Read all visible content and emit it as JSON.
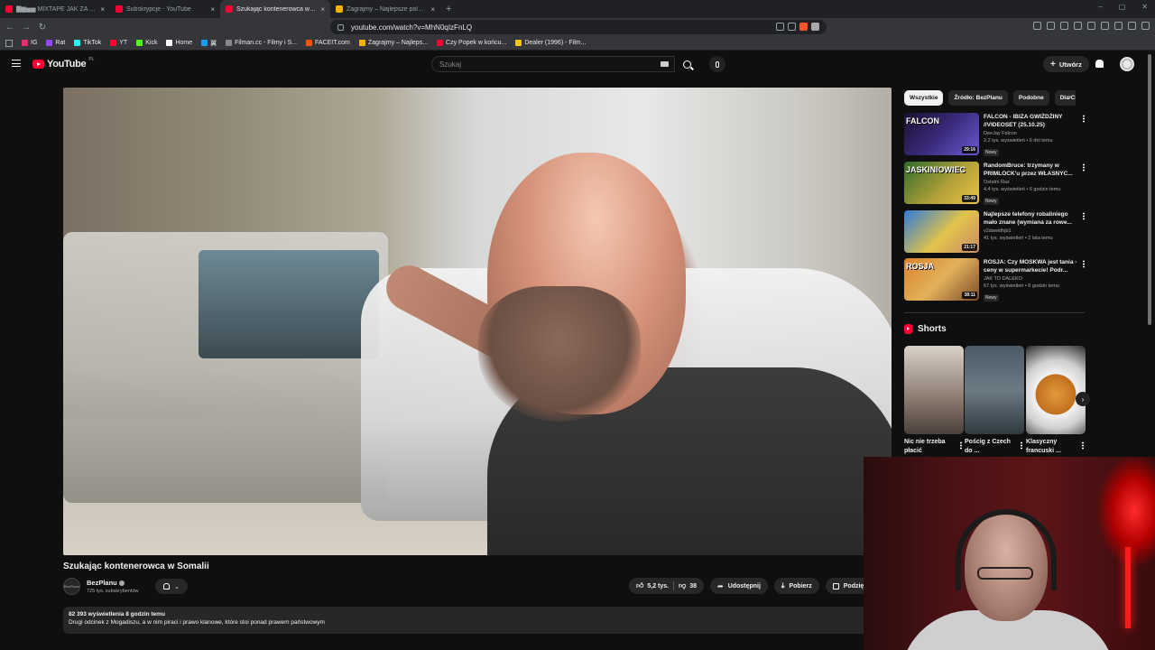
{
  "browser": {
    "tabs": [
      {
        "title": "▇▆▅▅ MIXTAPE JAK ZA D...",
        "color": "#ff0033",
        "active": false
      },
      {
        "title": "Subskrypcje - YouTube",
        "color": "#ff0033",
        "active": false
      },
      {
        "title": "Szukając kontenerowca w So...",
        "color": "#ff0033",
        "active": true
      },
      {
        "title": "Zagrajmy – Najlepsze polskie quizy",
        "color": "#f4b400",
        "active": false
      }
    ],
    "tab_close": "×",
    "new_tab": "+",
    "window_controls": [
      "–",
      "▢",
      "✕"
    ],
    "back": "←",
    "forward": "→",
    "reload": "↻",
    "url": "youtube.com/watch?v=MhN0qIzFnLQ",
    "bookmarks": [
      {
        "label": "IG",
        "color": "#e1306c"
      },
      {
        "label": "Rat",
        "color": "#9146ff"
      },
      {
        "label": "TikTok",
        "color": "#25f4ee"
      },
      {
        "label": "YT",
        "color": "#ff0033"
      },
      {
        "label": "Kick",
        "color": "#53fc18"
      },
      {
        "label": "Home",
        "color": "#ffffff"
      },
      {
        "label": "翼",
        "color": "#1d9bf0"
      },
      {
        "label": "Filman.cc - Filmy i S...",
        "color": "#888888"
      },
      {
        "label": "FACEIT.com",
        "color": "#ff5500"
      },
      {
        "label": "Zagrajmy – Najleps...",
        "color": "#f4b400"
      },
      {
        "label": "Czy Popek w końcu...",
        "color": "#ff0033"
      },
      {
        "label": "Dealer (1996) - Film...",
        "color": "#f5c518"
      }
    ]
  },
  "header": {
    "logo_text": "YouTube",
    "region": "PL",
    "search_placeholder": "Szukaj",
    "create_label": "Utwórz",
    "create_plus": "+"
  },
  "video": {
    "title": "Szukając kontenerowca w Somalii",
    "channel": "BezPlanu",
    "channel_avatar_text": "BezPlanu",
    "subscribers": "725 tys. subskrybentów",
    "bell_chevron": "⌄",
    "likes": "5,2 tys.",
    "dislikes": "38",
    "share_label": "Udostępnij",
    "download_label": "Pobierz",
    "thanks_label": "Podzięk",
    "views_time": "82 393 wyświetlenia  8 godzin temu",
    "description": "Drugi odcinek z Mogadiszu, a w nim piraci i prawo klanowe, które stoi ponad prawem państwowym"
  },
  "sidebar": {
    "chips": [
      "Wszystkie",
      "Źródło: BezPlanu",
      "Podobne",
      "Dla Ciebie"
    ],
    "chip_next": "›",
    "recommendations": [
      {
        "title": "FALCON - IBIZA GWIŻDŻINY //VIDEOSET (25.10.25)",
        "channel": "DeeJay Falcon",
        "stats": "2,2 tys. wyświetleń • 6 dni temu",
        "badge": "Nowy",
        "duration": "29:16",
        "thumb_text": "FALCON",
        "bg": "linear-gradient(135deg,#1a1030,#3a2a7a 50%,#6b5bd6)"
      },
      {
        "title": "RandomBruce: trzymany w PRIMLOCK'u przez WŁASNYC...",
        "channel": "Ostatni Raz",
        "stats": "4,4 tys. wyświetleń • 6 godzin temu",
        "badge": "Nowy",
        "duration": "33:49",
        "thumb_text": "JASKINIOWIEC",
        "bg": "linear-gradient(135deg,#2f6b2a,#b8a33a 60%,#e8c44a)"
      },
      {
        "title": "Najlepsze telefony robaliniego mało znane (wymiana za rowe...",
        "channel": "v2dawidhjb1",
        "stats": "41 tys. wyświetleń • 2 lata temu",
        "badge": "",
        "duration": "21:17",
        "thumb_text": "",
        "bg": "linear-gradient(135deg,#2e7bd8,#e2c34a 55%,#c98a6a)"
      },
      {
        "title": "ROSJA: Czy MOSKWA jest tania - ceny w supermarkecie! Podr...",
        "channel": "JAK TO DALEKO",
        "stats": "67 tys. wyświetleń • 8 godzin temu",
        "badge": "Nowy",
        "duration": "38:11",
        "thumb_text": "ROSJA",
        "bg": "linear-gradient(135deg,#d9822b,#e3b15a 50%,#7a4b2a)"
      }
    ],
    "shorts_title": "Shorts",
    "shorts": [
      {
        "title": "Nic nie trzeba płacić",
        "bg": "linear-gradient(180deg,#d9d1c8,#8a7a70 60%,#4a3f3a)"
      },
      {
        "title": "Pościg z Czech do ...",
        "bg": "linear-gradient(180deg,#4a5a66,#6c7a84 50%,#2f3a40)"
      },
      {
        "title": "Klasyczny francuski ...",
        "bg": "radial-gradient(circle at 50% 55%,#e39a3a 0%,#c0701f 35%,#f2f2f2 36%,#cfcfcf 60%,#2a2a2a 100%)"
      }
    ],
    "shorts_next": "›"
  }
}
